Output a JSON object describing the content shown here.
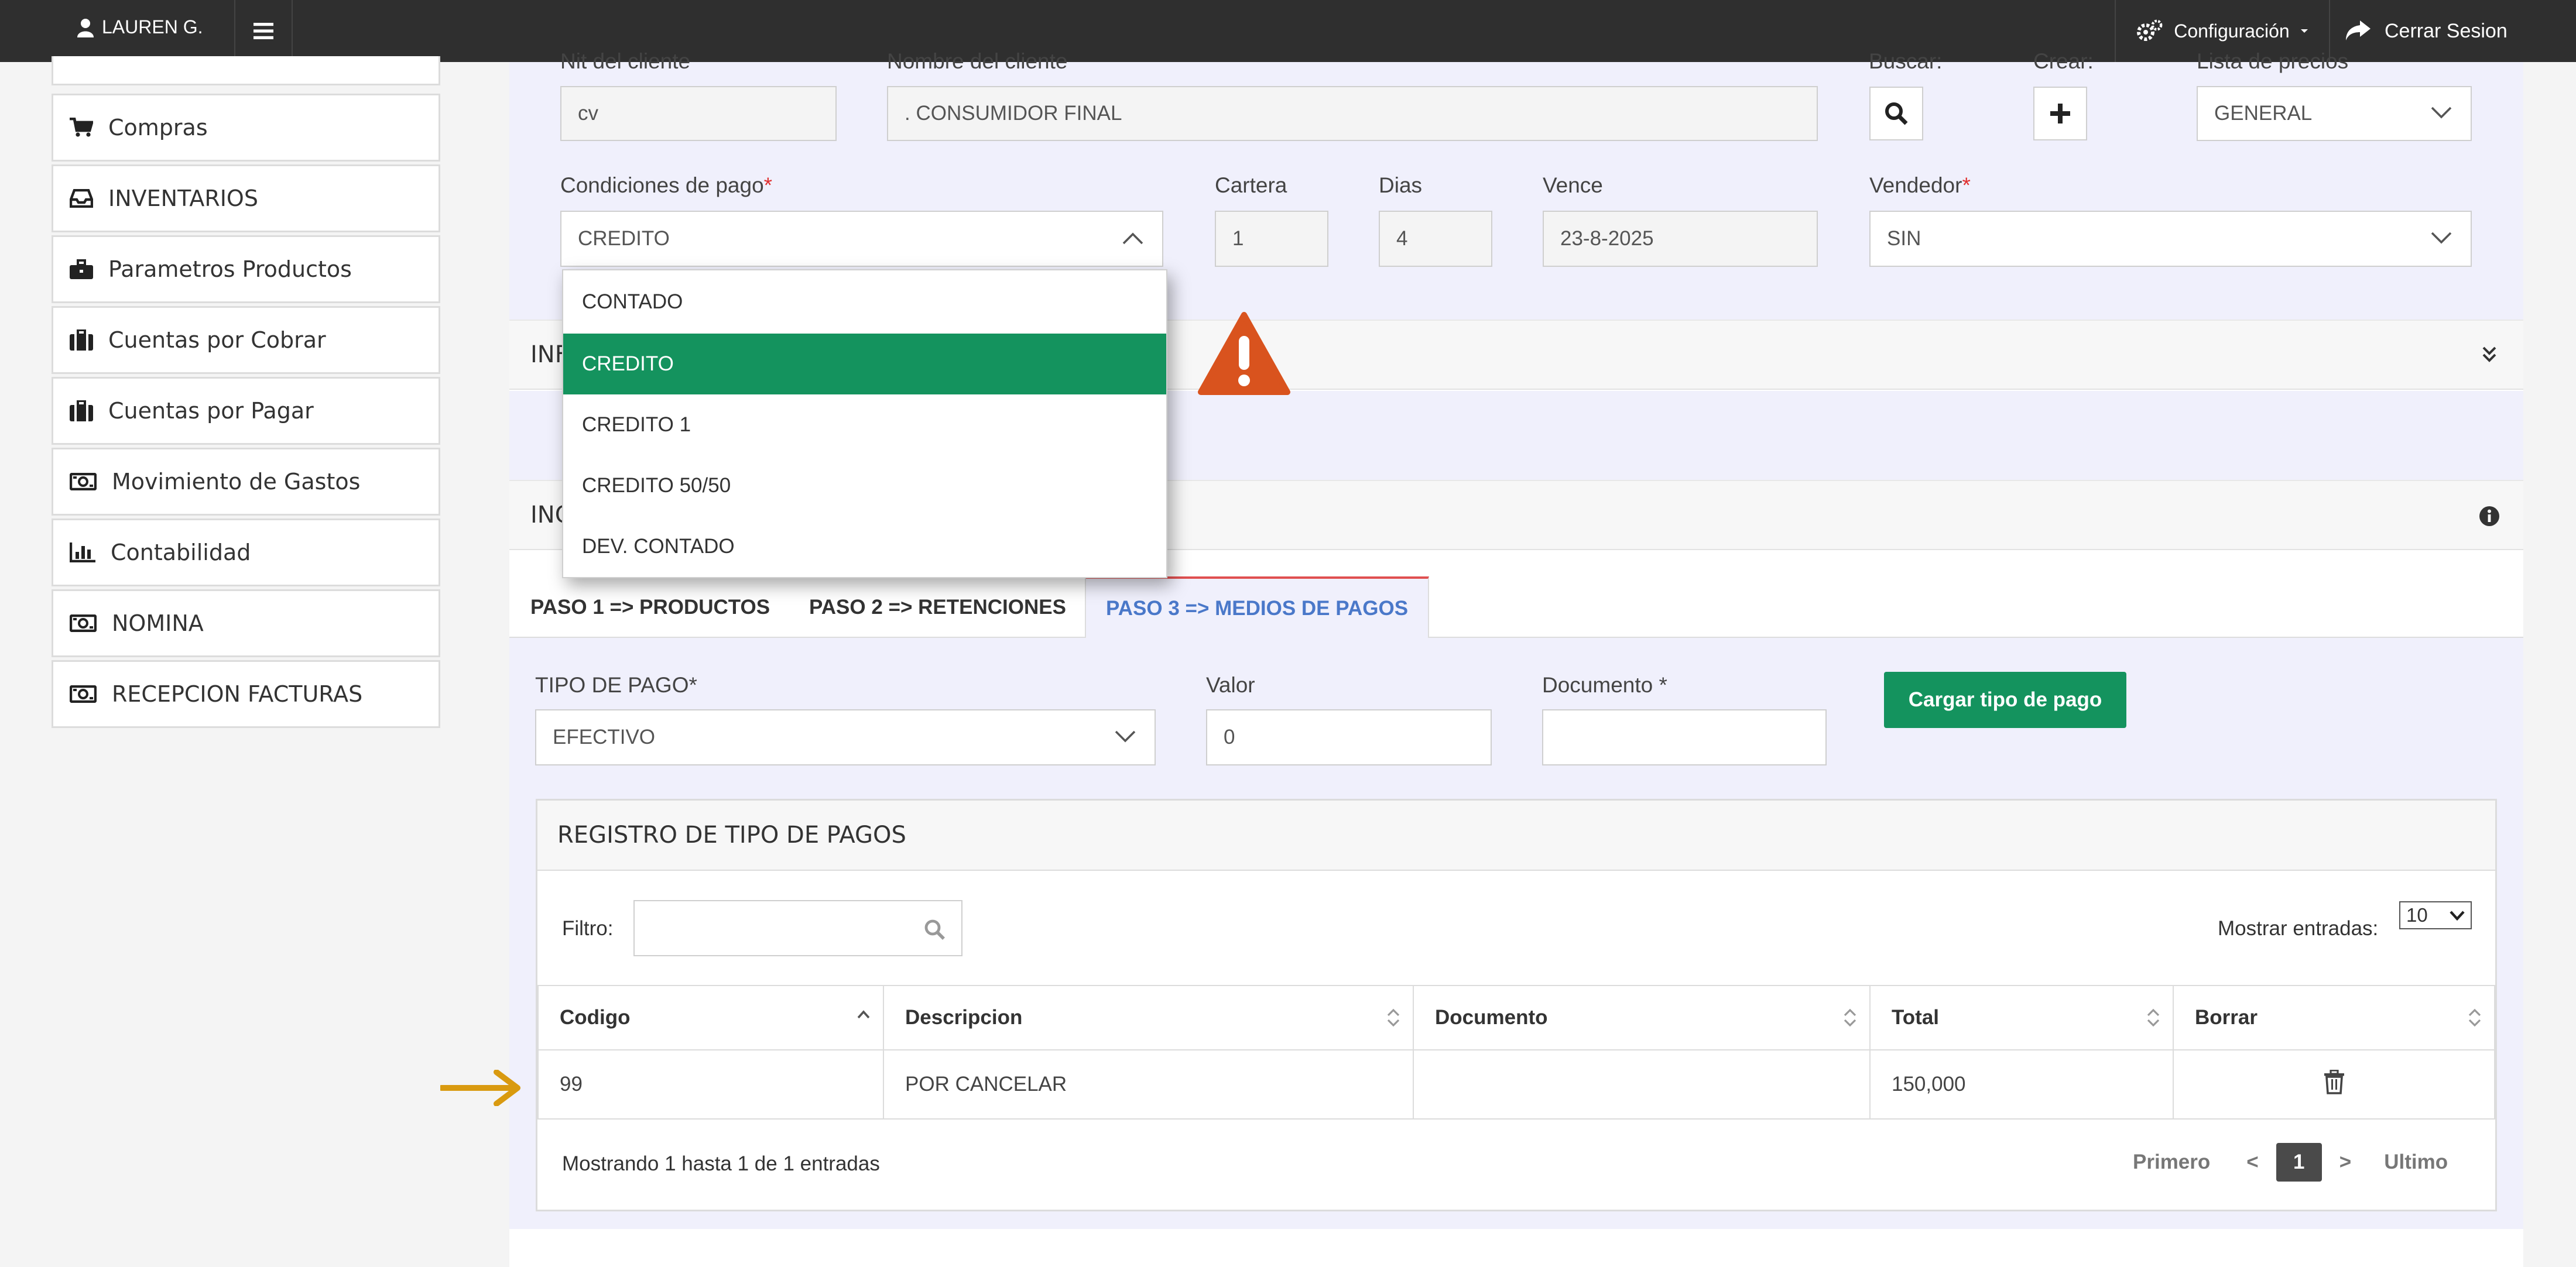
{
  "topbar": {
    "user_name": "LAUREN G.",
    "config_label": "Configuración",
    "logout_label": "Cerrar Sesion"
  },
  "sidebar": {
    "items": [
      {
        "label": "Compras",
        "icon": "cart-icon"
      },
      {
        "label": "INVENTARIOS",
        "icon": "inbox-icon"
      },
      {
        "label": "Parametros Productos",
        "icon": "briefcase-icon"
      },
      {
        "label": "Cuentas por Cobrar",
        "icon": "suitcase-icon"
      },
      {
        "label": "Cuentas por Pagar",
        "icon": "suitcase-icon"
      },
      {
        "label": "Movimiento de Gastos",
        "icon": "money-icon"
      },
      {
        "label": "Contabilidad",
        "icon": "bar-chart-icon"
      },
      {
        "label": "NOMINA",
        "icon": "money-icon"
      },
      {
        "label": "RECEPCION FACTURAS",
        "icon": "money-icon"
      }
    ]
  },
  "form": {
    "nit_label": "Nit del cliente",
    "nit_value": "cv",
    "nombre_label": "Nombre del cliente",
    "nombre_value": ".  CONSUMIDOR FINAL",
    "buscar_label": "Buscar:",
    "crear_label": "Crear:",
    "lista_label": "Lista de precios",
    "lista_value": "GENERAL",
    "condiciones_label": "Condiciones de pago",
    "condiciones_value": "CREDITO",
    "cartera_label": "Cartera",
    "cartera_value": "1",
    "dias_label": "Dias",
    "dias_value": "4",
    "vence_label": "Vence",
    "vence_value": "23-8-2025",
    "vendedor_label": "Vendedor",
    "vendedor_value": "SIN",
    "required_mark": "*"
  },
  "dropdown": {
    "options": [
      "CONTADO",
      "CREDITO",
      "CREDITO 1",
      "CREDITO 50/50",
      "DEV. CONTADO"
    ],
    "selected": "CREDITO"
  },
  "sections": {
    "info_title": "INF",
    "inc_title": "INC"
  },
  "tabs": [
    {
      "label": "PASO 1 => PRODUCTOS"
    },
    {
      "label": "PASO 2 => RETENCIONES"
    },
    {
      "label": "PASO 3 => MEDIOS DE PAGOS"
    }
  ],
  "payment": {
    "tipo_label": "TIPO DE PAGO*",
    "tipo_value": "EFECTIVO",
    "valor_label": "Valor",
    "valor_value": "0",
    "documento_label": "Documento *",
    "documento_value": "",
    "cargar_button": "Cargar tipo de pago"
  },
  "registro": {
    "title": "REGISTRO DE TIPO DE PAGOS",
    "filter_label": "Filtro:",
    "filter_value": "",
    "show_label": "Mostrar entradas:",
    "show_value": "10",
    "columns": [
      "Codigo",
      "Descripcion",
      "Documento",
      "Total",
      "Borrar"
    ],
    "rows": [
      {
        "codigo": "99",
        "descripcion": "POR CANCELAR",
        "documento": "",
        "total": "150,000"
      }
    ],
    "summary": "Mostrando 1 hasta 1 de 1 entradas",
    "pager": {
      "first": "Primero",
      "prev": "<",
      "current": "1",
      "next": ">",
      "last": "Ultimo"
    }
  },
  "colors": {
    "accent_green": "#14935e",
    "warning": "#d9531e",
    "arrow": "#d99a0f",
    "active_tab": "#4a78c9"
  }
}
